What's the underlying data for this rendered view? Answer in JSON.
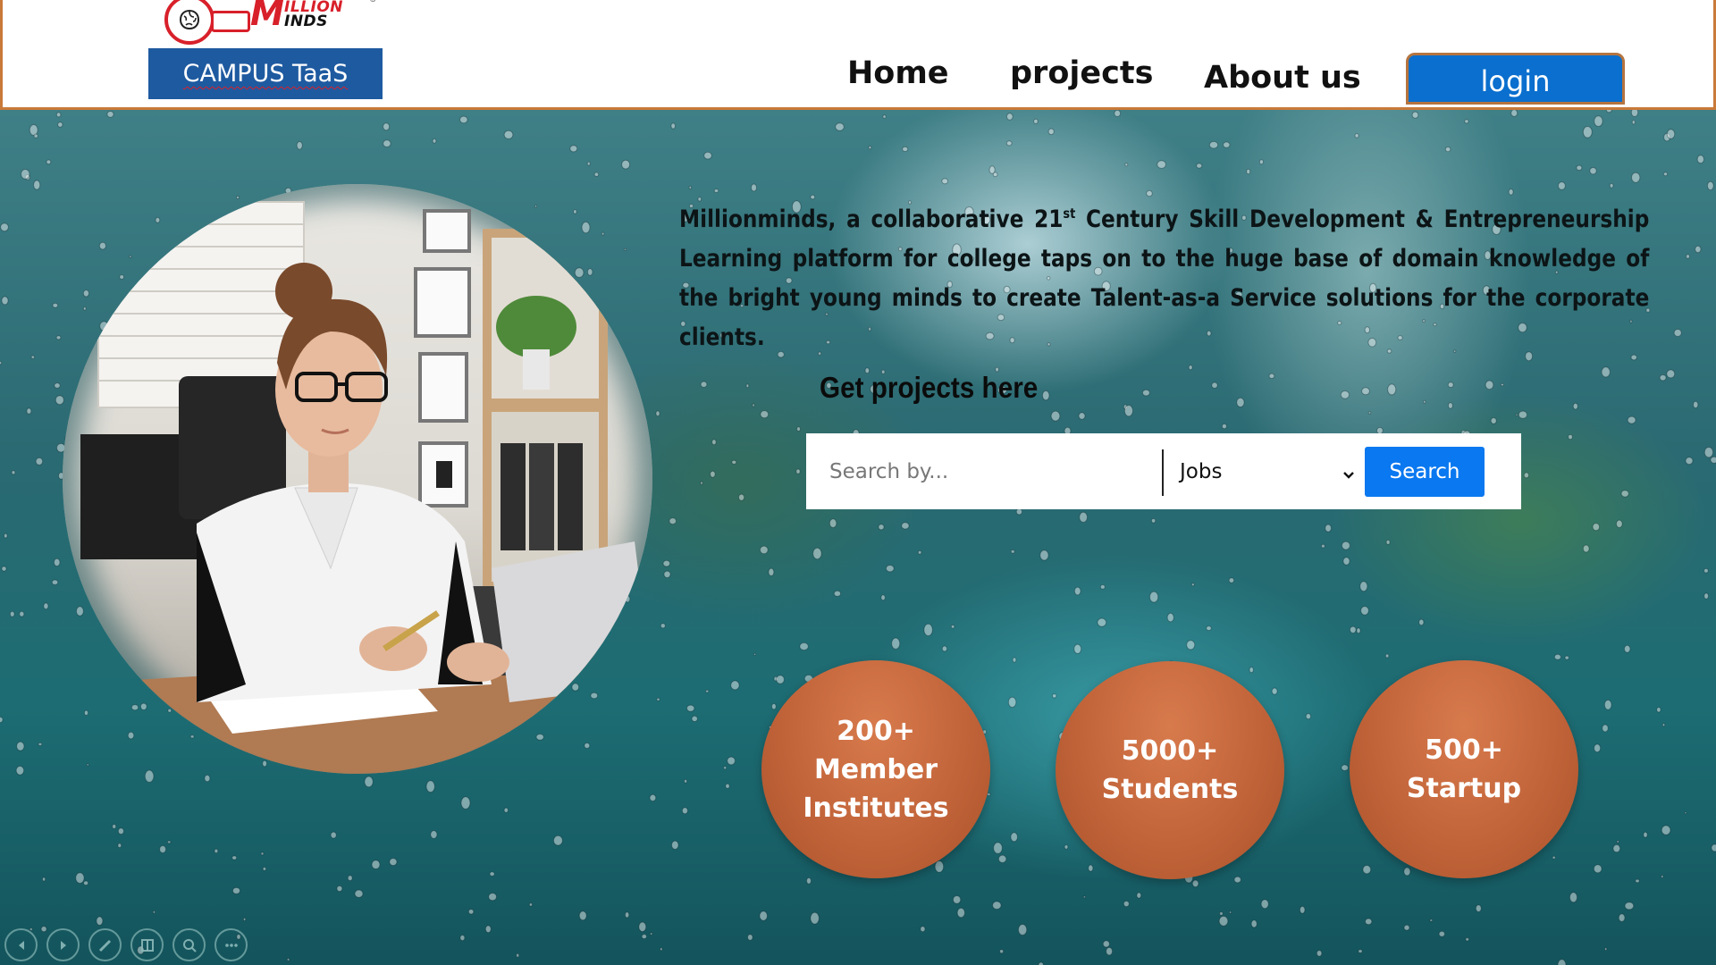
{
  "header": {
    "logo": {
      "brand_initial": "M",
      "brand_line1": "ILLION",
      "brand_line2": "INDS",
      "registered": "®",
      "campus_label": "CAMPUS TaaS"
    },
    "nav": {
      "home": "Home",
      "projects": "projects",
      "about": "About us"
    },
    "login_label": "login"
  },
  "hero": {
    "about_part1": "Millionminds, a collaborative 21",
    "about_sup": "st",
    "about_part2": " Century Skill Development & Entrepreneurship Learning  platform for college taps on to the huge base of domain knowledge of the bright young minds  to create Talent-as-a Service solutions for the corporate clients.",
    "projects_heading": "Get projects here",
    "search": {
      "placeholder": "Search by...",
      "category_selected": "Jobs",
      "button_label": "Search"
    },
    "stats": [
      {
        "label": "200+\nMember\nInstitutes"
      },
      {
        "label": "5000+\nStudents"
      },
      {
        "label": "500+\nStartup"
      }
    ]
  },
  "colors": {
    "brand_red": "#d8202a",
    "campus_blue": "#1e5aa0",
    "login_blue": "#0a6fce",
    "search_blue": "#0a78f0",
    "stat_orange": "#c2643a",
    "header_border": "#c97a3a"
  },
  "controls": [
    "previous-icon",
    "next-icon",
    "pen-icon",
    "slides-icon",
    "zoom-icon",
    "more-icon"
  ]
}
